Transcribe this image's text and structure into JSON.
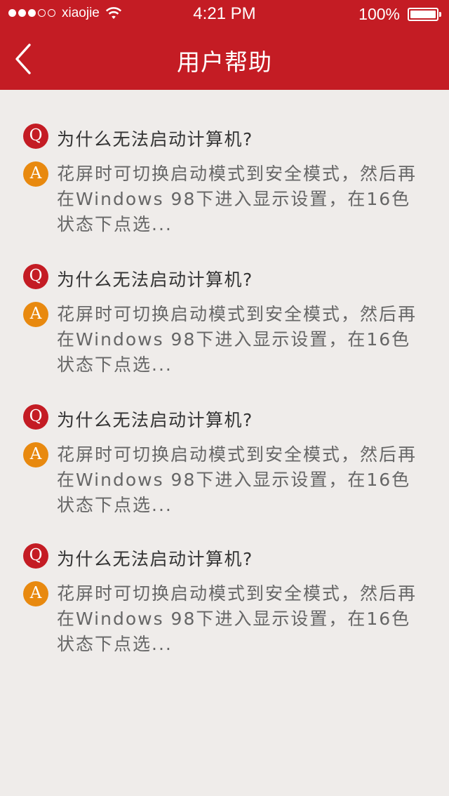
{
  "status_bar": {
    "carrier": "xiaojie",
    "time": "4:21 PM",
    "battery": "100%",
    "signal_strength": 3,
    "signal_max": 5
  },
  "nav": {
    "back_icon": "chevron-left-icon",
    "title": "用户帮助"
  },
  "colors": {
    "header_bg": "#c41c24",
    "question_badge": "#c41c24",
    "answer_badge": "#e8890f",
    "page_bg": "#efecea"
  },
  "faq": [
    {
      "q_badge": "Q",
      "question": "为什么无法启动计算机?",
      "a_badge": "A",
      "answer": "花屏时可切换启动模式到安全模式，然后再在Windows 98下进入显示设置，在16色状态下点选..."
    },
    {
      "q_badge": "Q",
      "question": "为什么无法启动计算机?",
      "a_badge": "A",
      "answer": "花屏时可切换启动模式到安全模式，然后再在Windows 98下进入显示设置，在16色状态下点选..."
    },
    {
      "q_badge": "Q",
      "question": "为什么无法启动计算机?",
      "a_badge": "A",
      "answer": "花屏时可切换启动模式到安全模式，然后再在Windows 98下进入显示设置，在16色状态下点选..."
    },
    {
      "q_badge": "Q",
      "question": "为什么无法启动计算机?",
      "a_badge": "A",
      "answer": "花屏时可切换启动模式到安全模式，然后再在Windows 98下进入显示设置，在16色状态下点选..."
    }
  ]
}
